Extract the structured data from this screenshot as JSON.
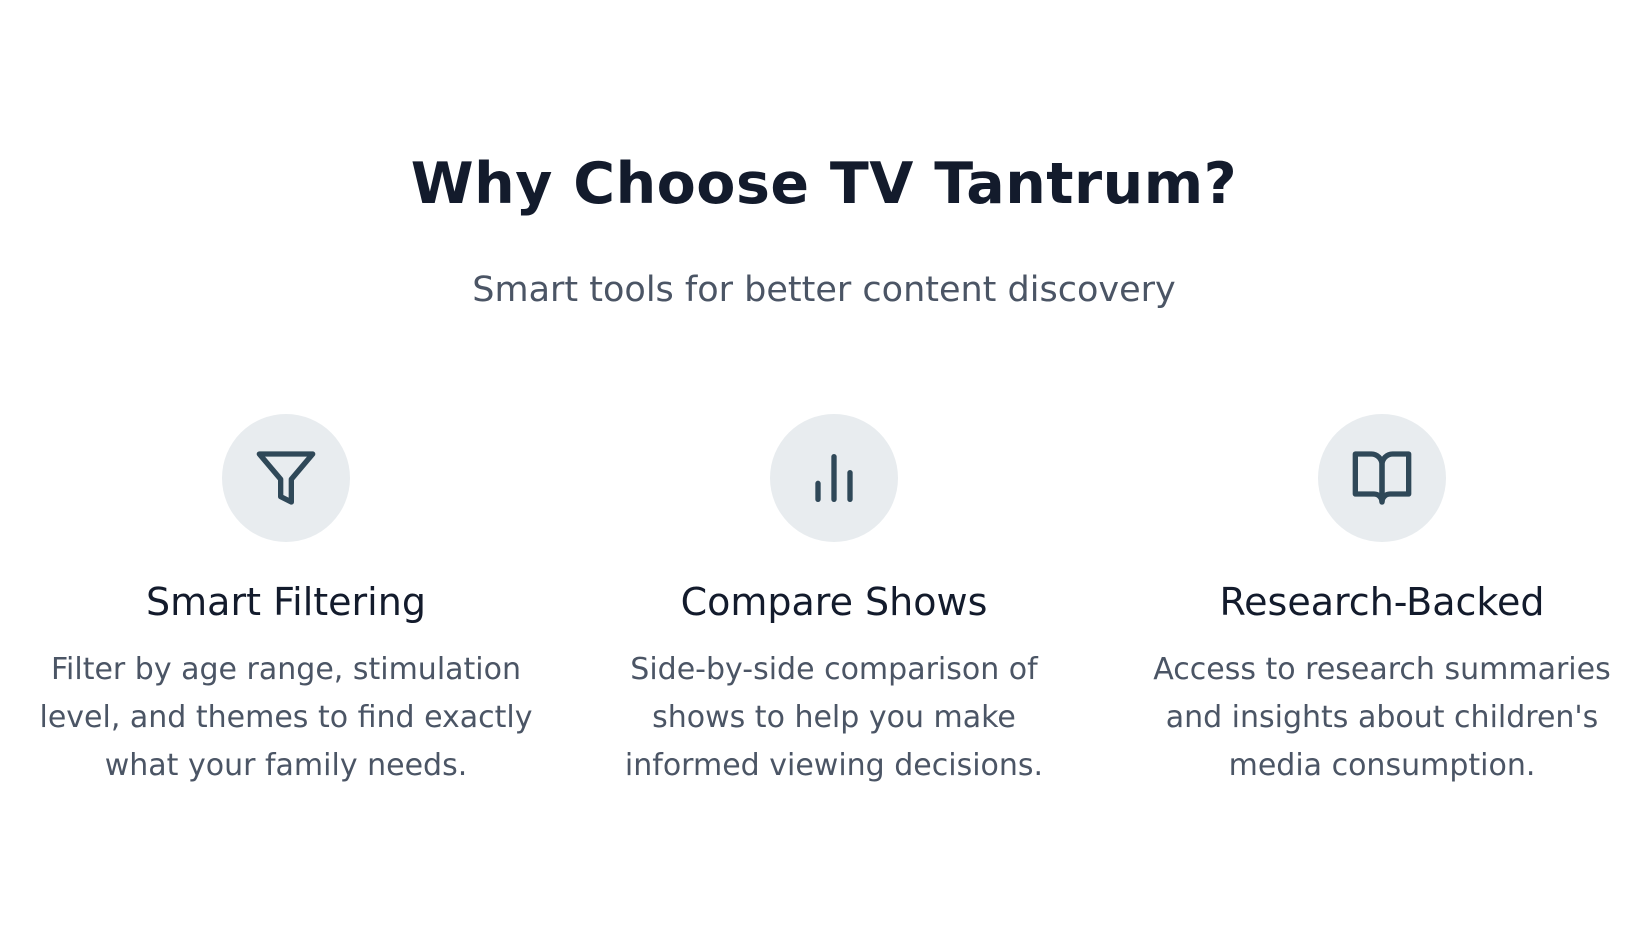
{
  "section": {
    "title": "Why Choose TV Tantrum?",
    "subtitle": "Smart tools for better content discovery"
  },
  "features": [
    {
      "icon": "filter-icon",
      "title": "Smart Filtering",
      "description": "Filter by age range, stimulation level, and themes to find exactly what your family needs."
    },
    {
      "icon": "bar-chart-icon",
      "title": "Compare Shows",
      "description": "Side-by-side comparison of shows to help you make informed viewing decisions."
    },
    {
      "icon": "book-open-icon",
      "title": "Research-Backed",
      "description": "Access to research summaries and insights about children's media consumption."
    }
  ],
  "colors": {
    "heading": "#131b2c",
    "body_text": "#4b5565",
    "icon_stroke": "#2f4858",
    "icon_circle_bg": "#e8ecef",
    "background": "#ffffff"
  }
}
